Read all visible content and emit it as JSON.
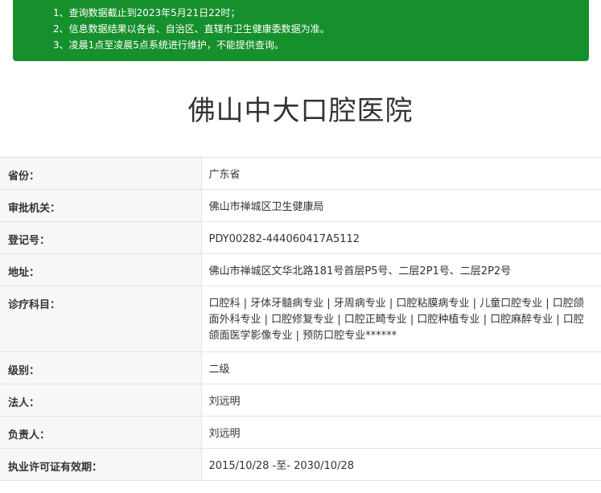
{
  "notice": {
    "items": [
      "1、查询数据截止到2023年5月21日22时；",
      "2、信息数据结果以各省、自治区、直辖市卫生健康委数据为准。",
      "3、凌晨1点至凌晨5点系统进行维护，不能提供查询。"
    ]
  },
  "hospital": {
    "name": "佛山中大口腔医院"
  },
  "rows": [
    {
      "label": "省份：",
      "value": "广东省"
    },
    {
      "label": "审批机关：",
      "value": "佛山市禅城区卫生健康局"
    },
    {
      "label": "登记号：",
      "value": "PDY00282-444060417A5112"
    },
    {
      "label": "地址：",
      "value": "佛山市禅城区文华北路181号首层P5号、二层2P1号、二层2P2号"
    },
    {
      "label": "诊疗科目：",
      "value": "口腔科 | 牙体牙髓病专业 | 牙周病专业 | 口腔粘膜病专业 | 儿童口腔专业 | 口腔颌面外科专业 | 口腔修复专业 | 口腔正畸专业 | 口腔种植专业 | 口腔麻醉专业 | 口腔颌面医学影像专业 | 预防口腔专业******"
    },
    {
      "label": "级别：",
      "value": "二级"
    },
    {
      "label": "法人：",
      "value": "刘远明"
    },
    {
      "label": "负责人：",
      "value": "刘远明"
    },
    {
      "label": "执业许可证有效期：",
      "value": "2015/10/28 -至- 2030/10/28"
    }
  ],
  "colors": {
    "notice_bg": "#168f2d",
    "label_bg": "#f7f7f7",
    "border": "#e3e3e3"
  }
}
